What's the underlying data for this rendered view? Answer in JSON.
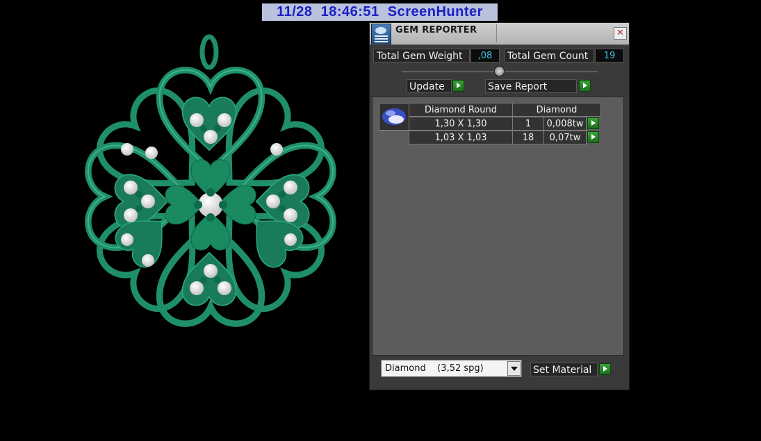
{
  "overlay": {
    "stamp": "11/28  18:46:51  ScreenHunter"
  },
  "viewport": {
    "object": "heart-clover-pendant",
    "color": "#1f8f68"
  },
  "panel": {
    "title": "GEM REPORTER",
    "close_symbol": "✕",
    "total_weight_label": "Total Gem Weight",
    "total_weight_value": ",08",
    "total_count_label": "Total Gem Count",
    "total_count_value": "19",
    "update_label": "Update",
    "save_report_label": "Save Report",
    "table": {
      "headers": [
        "Diamond Round",
        "Diamond"
      ],
      "rows": [
        {
          "size": "1,30 X 1,30",
          "count": "1",
          "weight": "0,008tw"
        },
        {
          "size": "1,03 X 1,03",
          "count": "18",
          "weight": "0,07tw"
        }
      ]
    },
    "material": {
      "name": "Diamond",
      "density": "(3,52 spg)"
    },
    "set_material_label": "Set Material"
  }
}
